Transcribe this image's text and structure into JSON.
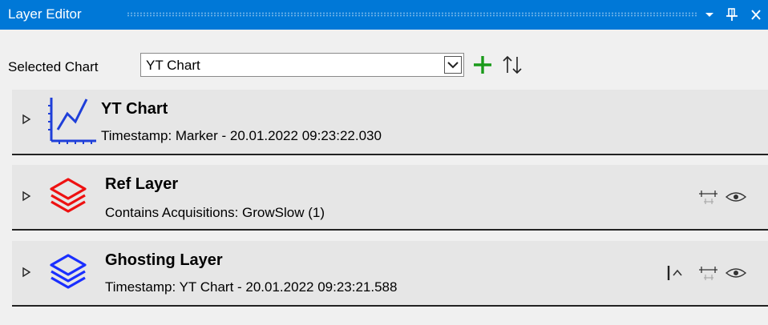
{
  "window": {
    "title": "Layer Editor",
    "buttons": [
      "dropdown-icon",
      "pin-icon",
      "close-icon"
    ]
  },
  "toolbar": {
    "selected_chart_label": "Selected Chart",
    "selected_chart_value": "YT Chart",
    "add_icon": "plus-icon",
    "sort_icon": "sort-icon"
  },
  "layers": [
    {
      "name": "YT Chart",
      "subtitle": "Timestamp: Marker - 20.01.2022 09:23:22.030",
      "icon": "line-chart-icon",
      "icon_color": "#1f3fd9"
    },
    {
      "name": "Ref Layer",
      "subtitle": "Contains Acquisitions: GrowSlow (1)",
      "icon": "layers-icon",
      "icon_color": "#ee1111"
    },
    {
      "name": "Ghosting Layer",
      "subtitle": "Timestamp: YT Chart - 20.01.2022 09:23:21.588",
      "icon": "layers-icon",
      "icon_color": "#1a2fff"
    }
  ],
  "colors": {
    "titlebar": "#0078d7",
    "add_green": "#1a9a1a",
    "row_background": "#e6e6e6"
  }
}
